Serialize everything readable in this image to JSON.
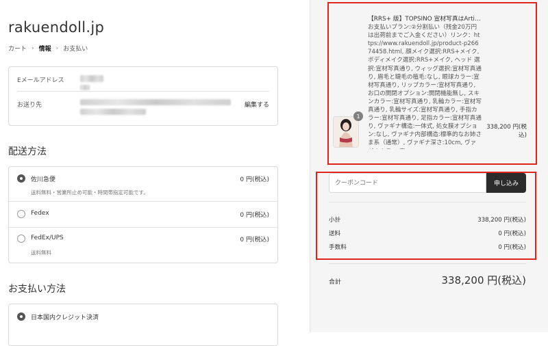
{
  "store": {
    "name": "rakuendoll.jp"
  },
  "breadcrumb": {
    "cart": "カート",
    "info": "情報",
    "payment": "お支払い"
  },
  "contact": {
    "email_label": "Eメールアドレス",
    "ship_to_label": "お送り先",
    "edit_label": "編集する"
  },
  "shipping": {
    "title": "配送方法",
    "options": [
      {
        "name": "佐川急便",
        "sub": "送料無料・営業所止め可能・時間帯指定可能です。",
        "price": "0 円(税込)",
        "selected": true
      },
      {
        "name": "Fedex",
        "sub": "",
        "price": "0 円(税込)",
        "selected": false
      },
      {
        "name": "FedEx/UPS",
        "sub": "送料無料",
        "price": "0 円(税込)",
        "selected": false
      }
    ]
  },
  "payment": {
    "title": "お支払い方法",
    "option": "日本国内クレジット決済"
  },
  "order": {
    "item": {
      "quantity": "1",
      "title": "【RRS+ 版】TOPSINO 宣材写真はArtist Makeup ラブドール最新作 153cm&E…",
      "description": "お支払いプラン:②分割払い（残金20万円は出荷前までご入金ください）リンク：https://www.rakuendoll.jp/product-p26674458.html, 顔メイク選択:RRS+メイク, ボディメイク選択:RRS+メイク, ヘッド 選択:宣材写真通り, ウィッグ選択:宣材写真通り, 眉毛と睫毛の植毛:なし, 眼球カラー:宣材写真通り, リップカラー:宣材写真通り, お口の開閉オプション:開閉機能無し, スキンカラー:宣材写真通り, 乳輪カラー:宣材写真通り, 乳輪サイズ:宣材写真通り, 手指カラー:宣材写真通り, 足指カラー:宣材写真通り, ヴァギナ構造:一体式, 処女膜オプション:なし, ヴァギナ内部構造:標準的なお姉さま系（通常）, ヴァギナ深さ:10cm, ヴァギナカラー:宣",
      "price": "338,200 円(税込)"
    },
    "coupon_placeholder": "クーポンコード",
    "apply_label": "申し込み",
    "subtotal_label": "小計",
    "subtotal": "338,200 円(税込)",
    "shipping_label": "送料",
    "shipping": "0 円(税込)",
    "fee_label": "手数料",
    "fee": "0 円(税込)",
    "total_label": "合計",
    "total": "338,200 円(税込)"
  },
  "colors": {
    "highlight": "#e0241b",
    "button": "#2b2b2b",
    "sidebar_bg": "#f5f5f5"
  }
}
